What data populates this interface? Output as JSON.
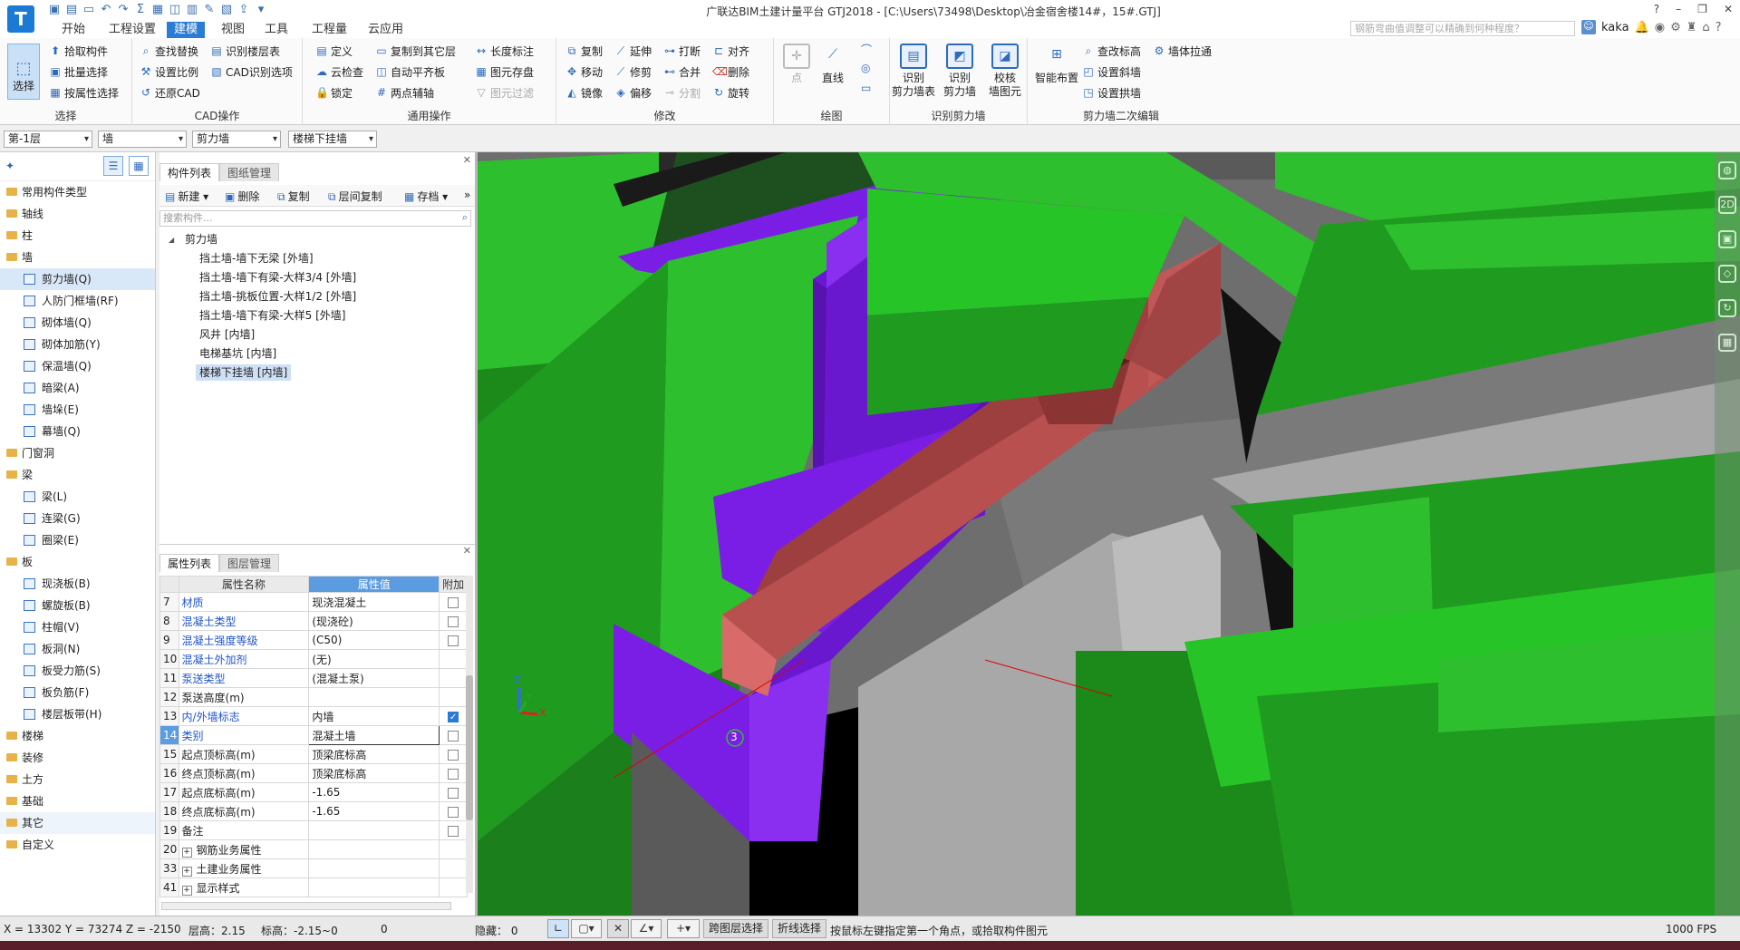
{
  "app": {
    "logo": "T",
    "title": "广联达BIM土建计量平台 GTJ2018 - [C:\\Users\\73498\\Desktop\\冶金宿舍楼14#，15#.GTJ]",
    "search_placeholder": "钢筋弯曲值调整可以精确到何种程度？",
    "user": "kaka"
  },
  "menu": [
    "开始",
    "工程设置",
    "建模",
    "视图",
    "工具",
    "工程量",
    "云应用"
  ],
  "menu_active": 2,
  "ribbon": {
    "select": {
      "big": "选择",
      "items": [
        "拾取构件",
        "批量选择",
        "按属性选择"
      ],
      "label": "选择"
    },
    "cad": {
      "items": [
        "查找替换",
        "设置比例",
        "还原CAD",
        "识别楼层表",
        "CAD识别选项"
      ],
      "label": "CAD操作"
    },
    "common": {
      "items": [
        "定义",
        "云检查",
        "锁定",
        "复制到其它层",
        "自动平齐板",
        "两点辅轴",
        "长度标注",
        "图元存盘",
        "图元过滤"
      ],
      "label": "通用操作"
    },
    "modify": {
      "items": [
        "复制",
        "移动",
        "镜像",
        "延伸",
        "修剪",
        "偏移",
        "打断",
        "合并",
        "分割",
        "对齐",
        "删除",
        "旋转"
      ],
      "label": "修改"
    },
    "draw": {
      "items": [
        "点",
        "直线"
      ],
      "label": "绘图"
    },
    "recognize": {
      "items": [
        "识别\n剪力墙表",
        "识别\n剪力墙",
        "校核\n墙图元"
      ],
      "label": "识别剪力墙"
    },
    "edit2": {
      "items": [
        "智能布置",
        "查改标高",
        "设置斜墙",
        "设置拱墙",
        "墙体拉通"
      ],
      "label": "剪力墙二次编辑"
    }
  },
  "filters": [
    "第-1层",
    "墙",
    "剪力墙",
    "楼梯下挂墙"
  ],
  "nav_tree": [
    {
      "label": "常用构件类型",
      "type": "cat"
    },
    {
      "label": "轴线",
      "type": "cat"
    },
    {
      "label": "柱",
      "type": "cat"
    },
    {
      "label": "墙",
      "type": "cat"
    },
    {
      "label": "剪力墙(Q)",
      "type": "sub",
      "selected": true
    },
    {
      "label": "人防门框墙(RF)",
      "type": "sub"
    },
    {
      "label": "砌体墙(Q)",
      "type": "sub"
    },
    {
      "label": "砌体加筋(Y)",
      "type": "sub"
    },
    {
      "label": "保温墙(Q)",
      "type": "sub"
    },
    {
      "label": "暗梁(A)",
      "type": "sub"
    },
    {
      "label": "墙垛(E)",
      "type": "sub"
    },
    {
      "label": "幕墙(Q)",
      "type": "sub"
    },
    {
      "label": "门窗洞",
      "type": "cat"
    },
    {
      "label": "梁",
      "type": "cat"
    },
    {
      "label": "梁(L)",
      "type": "sub"
    },
    {
      "label": "连梁(G)",
      "type": "sub"
    },
    {
      "label": "圈梁(E)",
      "type": "sub"
    },
    {
      "label": "板",
      "type": "cat"
    },
    {
      "label": "现浇板(B)",
      "type": "sub"
    },
    {
      "label": "螺旋板(B)",
      "type": "sub"
    },
    {
      "label": "柱帽(V)",
      "type": "sub"
    },
    {
      "label": "板洞(N)",
      "type": "sub"
    },
    {
      "label": "板受力筋(S)",
      "type": "sub"
    },
    {
      "label": "板负筋(F)",
      "type": "sub"
    },
    {
      "label": "楼层板带(H)",
      "type": "sub"
    },
    {
      "label": "楼梯",
      "type": "cat"
    },
    {
      "label": "装修",
      "type": "cat"
    },
    {
      "label": "土方",
      "type": "cat"
    },
    {
      "label": "基础",
      "type": "cat"
    },
    {
      "label": "其它",
      "type": "cat",
      "hover": true
    },
    {
      "label": "自定义",
      "type": "cat"
    }
  ],
  "component_panel": {
    "tabs": [
      "构件列表",
      "图纸管理"
    ],
    "toolbar": [
      "新建",
      "删除",
      "复制",
      "层间复制",
      "存档"
    ],
    "search_placeholder": "搜索构件...",
    "root": "剪力墙",
    "items": [
      "挡土墙-墙下无梁 [外墙]",
      "挡土墙-墙下有梁-大样3/4 [外墙]",
      "挡土墙-挑板位置-大样1/2 [外墙]",
      "挡土墙-墙下有梁-大样5 [外墙]",
      "风井 [内墙]",
      "电梯基坑 [内墙]",
      "楼梯下挂墙 [内墙]"
    ],
    "selected_index": 6
  },
  "property_panel": {
    "tabs": [
      "属性列表",
      "图层管理"
    ],
    "headers": [
      "属性名称",
      "属性值",
      "附加"
    ],
    "rows": [
      {
        "no": "7",
        "name": "材质",
        "value": "现浇混凝土",
        "blue": true,
        "check": false
      },
      {
        "no": "8",
        "name": "混凝土类型",
        "value": "(现浇砼)",
        "blue": true,
        "check": false
      },
      {
        "no": "9",
        "name": "混凝土强度等级",
        "value": "(C50)",
        "blue": true,
        "check": false
      },
      {
        "no": "10",
        "name": "混凝土外加剂",
        "value": "(无)",
        "blue": true,
        "check": null
      },
      {
        "no": "11",
        "name": "泵送类型",
        "value": "(混凝土泵)",
        "blue": true,
        "check": null
      },
      {
        "no": "12",
        "name": "泵送高度(m)",
        "value": "",
        "blue": false,
        "check": null
      },
      {
        "no": "13",
        "name": "内/外墙标志",
        "value": "内墙",
        "blue": true,
        "check": true
      },
      {
        "no": "14",
        "name": "类别",
        "value": "混凝土墙",
        "blue": true,
        "check": false,
        "editing": true
      },
      {
        "no": "15",
        "name": "起点顶标高(m)",
        "value": "顶梁底标高",
        "blue": false,
        "check": false
      },
      {
        "no": "16",
        "name": "终点顶标高(m)",
        "value": "顶梁底标高",
        "blue": false,
        "check": false
      },
      {
        "no": "17",
        "name": "起点底标高(m)",
        "value": "-1.65",
        "blue": false,
        "check": false
      },
      {
        "no": "18",
        "name": "终点底标高(m)",
        "value": "-1.65",
        "blue": false,
        "check": false
      },
      {
        "no": "19",
        "name": "备注",
        "value": "",
        "blue": false,
        "check": false
      },
      {
        "no": "20",
        "name": "钢筋业务属性",
        "value": "",
        "blue": false,
        "check": null,
        "expand": true
      },
      {
        "no": "33",
        "name": "土建业务属性",
        "value": "",
        "blue": false,
        "check": null,
        "expand": true
      },
      {
        "no": "41",
        "name": "显示样式",
        "value": "",
        "blue": false,
        "check": null,
        "expand": true
      }
    ]
  },
  "viewport": {
    "axis_marker": "3",
    "axis_labels": [
      "Z",
      "Y",
      "X"
    ]
  },
  "status": {
    "coords": "X = 13302 Y = 73274 Z = -2150",
    "floor_height": "层高：2.15",
    "elevation": "标高：-2.15~0",
    "zero": "0",
    "hidden": "隐藏： 0",
    "btn_cross_layer": "跨图层选择",
    "btn_polyline": "折线选择",
    "hint": "按鼠标左键指定第一个角点，或拾取构件图元",
    "fps": "1000 FPS"
  }
}
